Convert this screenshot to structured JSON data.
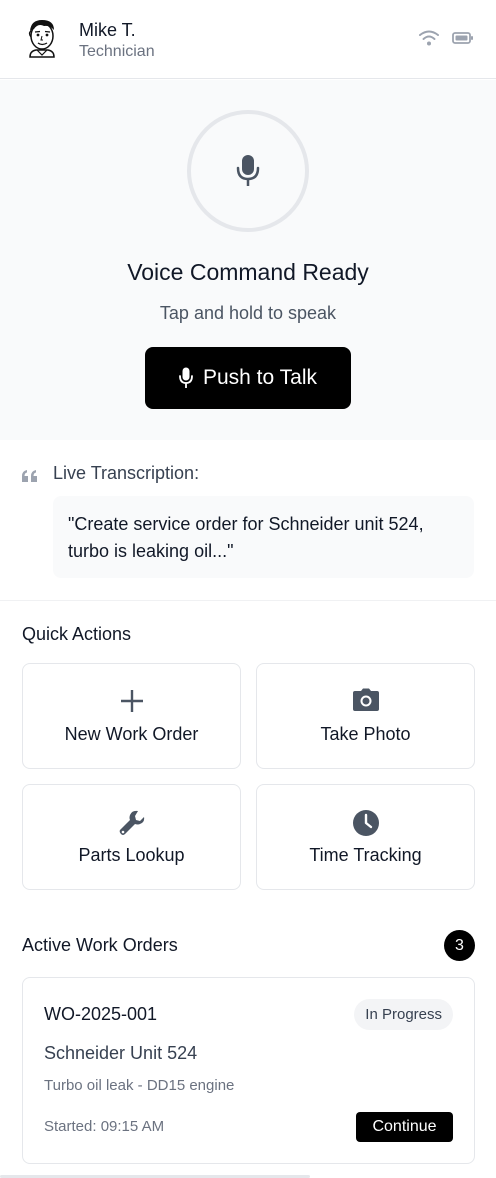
{
  "header": {
    "user_name": "Mike T.",
    "user_role": "Technician",
    "icons": [
      "avatar-cartoon",
      "wifi-icon",
      "battery-icon"
    ]
  },
  "voice": {
    "title": "Voice Command Ready",
    "subtitle": "Tap and hold to speak",
    "button_label": "Push to Talk",
    "icon": "microphone-icon"
  },
  "transcription": {
    "label": "Live Transcription:",
    "text": "\"Create service order for Schneider unit 524, turbo is leaking oil...\""
  },
  "quick_actions": {
    "title": "Quick Actions",
    "items": [
      {
        "label": "New Work Order",
        "icon": "plus-icon"
      },
      {
        "label": "Take Photo",
        "icon": "camera-icon"
      },
      {
        "label": "Parts Lookup",
        "icon": "wrench-icon"
      },
      {
        "label": "Time Tracking",
        "icon": "clock-icon"
      }
    ]
  },
  "work_orders": {
    "title": "Active Work Orders",
    "count": "3",
    "items": [
      {
        "id": "WO-2025-001",
        "status": "In Progress",
        "unit": "Schneider Unit 524",
        "description": "Turbo oil leak - DD15 engine",
        "started": "Started: 09:15 AM",
        "action_label": "Continue"
      }
    ]
  },
  "colors": {
    "primary": "#000000",
    "panel_bg": "#f9fafb",
    "border": "#e5e7eb",
    "muted_text": "#6b7280",
    "icon_gray": "#4b5563"
  }
}
